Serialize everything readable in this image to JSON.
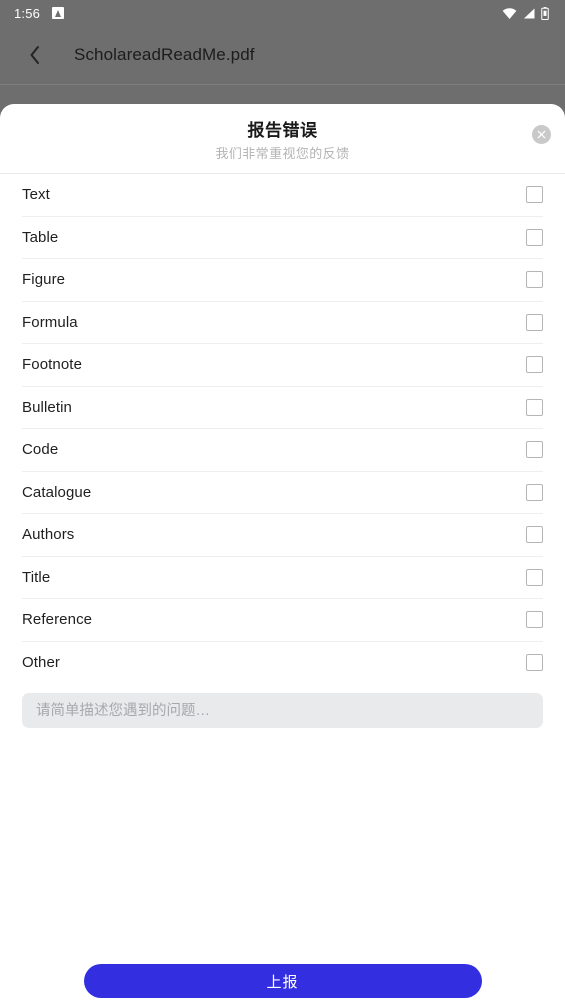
{
  "status_bar": {
    "clock": "1:56",
    "app_icon": "app-notification-icon",
    "wifi_icon": "wifi-icon",
    "signal_icon": "cellular-signal-icon",
    "battery_icon": "battery-icon"
  },
  "toolbar": {
    "back_icon": "chevron-left-icon",
    "title": "ScholareadReadMe.pdf",
    "background_color": "#6e6e6e"
  },
  "sheet": {
    "title": "报告错误",
    "subtitle": "我们非常重视您的反馈",
    "close_icon": "close-icon"
  },
  "categories": [
    {
      "label": "Text",
      "checked": false
    },
    {
      "label": "Table",
      "checked": false
    },
    {
      "label": "Figure",
      "checked": false
    },
    {
      "label": "Formula",
      "checked": false
    },
    {
      "label": "Footnote",
      "checked": false
    },
    {
      "label": "Bulletin",
      "checked": false
    },
    {
      "label": "Code",
      "checked": false
    },
    {
      "label": "Catalogue",
      "checked": false
    },
    {
      "label": "Authors",
      "checked": false
    },
    {
      "label": "Title",
      "checked": false
    },
    {
      "label": "Reference",
      "checked": false
    },
    {
      "label": "Other",
      "checked": false
    }
  ],
  "description": {
    "value": "",
    "placeholder": "请简单描述您遇到的问题…"
  },
  "submit": {
    "label": "上报",
    "accent_color": "#332fe0"
  }
}
